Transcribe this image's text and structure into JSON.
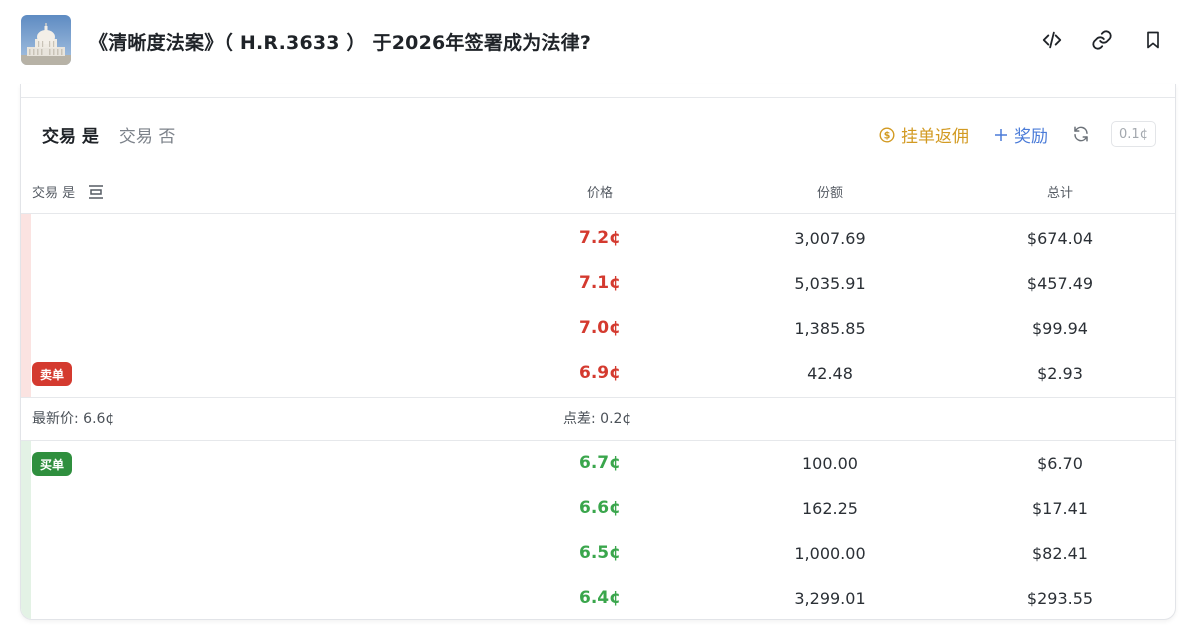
{
  "header": {
    "title": "《清晰度法案》（ H.R.3633 ） 于2026年签署成为法律?",
    "icons": [
      "code-icon",
      "link-icon",
      "bookmark-icon"
    ]
  },
  "tabs": [
    {
      "label": "交易 是",
      "active": true
    },
    {
      "label": "交易 否",
      "active": false
    }
  ],
  "actions": {
    "rebate_label": "挂单返佣",
    "reward_label": "奖励",
    "tick_size": "0.1¢"
  },
  "columns": {
    "side": "交易 是",
    "price": "价格",
    "shares": "份额",
    "total": "总计"
  },
  "asks": [
    {
      "price": "7.2¢",
      "shares": "3,007.69",
      "total": "$674.04"
    },
    {
      "price": "7.1¢",
      "shares": "5,035.91",
      "total": "$457.49"
    },
    {
      "price": "7.0¢",
      "shares": "1,385.85",
      "total": "$99.94"
    },
    {
      "price": "6.9¢",
      "shares": "42.48",
      "total": "$2.93"
    }
  ],
  "asks_badge": "卖单",
  "spread_row": {
    "last_price": "最新价: 6.6¢",
    "spread": "点差: 0.2¢"
  },
  "bids": [
    {
      "price": "6.7¢",
      "shares": "100.00",
      "total": "$6.70"
    },
    {
      "price": "6.6¢",
      "shares": "162.25",
      "total": "$17.41"
    },
    {
      "price": "6.5¢",
      "shares": "1,000.00",
      "total": "$82.41"
    },
    {
      "price": "6.4¢",
      "shares": "3,299.01",
      "total": "$293.55"
    }
  ],
  "bids_badge": "买单",
  "colors": {
    "ask": "#d43a2f",
    "bid": "#3aa64c",
    "ask_depth": "#fbe3e1",
    "bid_depth": "#e3f2e5",
    "rebate": "#d29a22",
    "reward": "#4a7bd8"
  }
}
